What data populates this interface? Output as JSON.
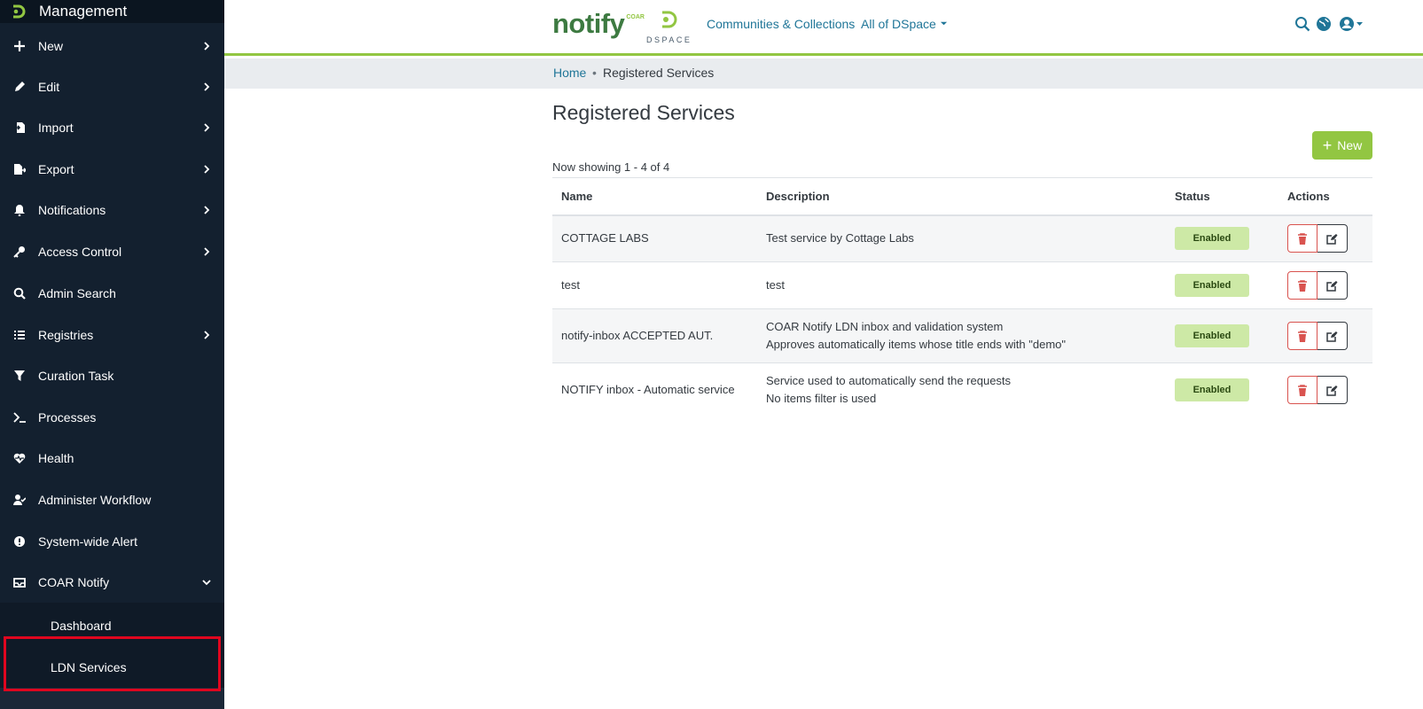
{
  "sidebar": {
    "title": "Management",
    "items": [
      {
        "label": "New",
        "icon": "plus-icon",
        "chevron": "right"
      },
      {
        "label": "Edit",
        "icon": "pencil-icon",
        "chevron": "right"
      },
      {
        "label": "Import",
        "icon": "file-import-icon",
        "chevron": "right"
      },
      {
        "label": "Export",
        "icon": "file-export-icon",
        "chevron": "right"
      },
      {
        "label": "Notifications",
        "icon": "bell-icon",
        "chevron": "right"
      },
      {
        "label": "Access Control",
        "icon": "key-icon",
        "chevron": "right"
      },
      {
        "label": "Admin Search",
        "icon": "search-icon",
        "chevron": ""
      },
      {
        "label": "Registries",
        "icon": "list-icon",
        "chevron": "right"
      },
      {
        "label": "Curation Task",
        "icon": "filter-icon",
        "chevron": ""
      },
      {
        "label": "Processes",
        "icon": "terminal-icon",
        "chevron": ""
      },
      {
        "label": "Health",
        "icon": "heartbeat-icon",
        "chevron": ""
      },
      {
        "label": "Administer Workflow",
        "icon": "user-check-icon",
        "chevron": ""
      },
      {
        "label": "System-wide Alert",
        "icon": "exclamation-circle-icon",
        "chevron": ""
      },
      {
        "label": "COAR Notify",
        "icon": "inbox-icon",
        "chevron": "down"
      }
    ],
    "subitems": [
      {
        "label": "Dashboard"
      },
      {
        "label": "LDN Services"
      }
    ]
  },
  "header": {
    "brand": "notify",
    "brand_sup": "COAR",
    "dspace": "DSPACE",
    "links": [
      "Communities & Collections",
      "All of DSpace"
    ]
  },
  "breadcrumb": {
    "home": "Home",
    "current": "Registered Services"
  },
  "main": {
    "title": "Registered Services",
    "new_label": "New",
    "showing": "Now showing 1 - 4 of 4",
    "columns": [
      "Name",
      "Description",
      "Status",
      "Actions"
    ],
    "rows": [
      {
        "name": "COTTAGE LABS",
        "desc1": "Test service by Cottage Labs",
        "desc2": "",
        "status": "Enabled"
      },
      {
        "name": "test",
        "desc1": "test",
        "desc2": "",
        "status": "Enabled"
      },
      {
        "name": "notify-inbox ACCEPTED AUT.",
        "desc1": "COAR Notify LDN inbox and validation system",
        "desc2": "Approves automatically items whose title ends with \"demo\"",
        "status": "Enabled"
      },
      {
        "name": "NOTIFY inbox - Automatic service",
        "desc1": "Service used to automatically send the requests",
        "desc2": "No items filter is used",
        "status": "Enabled"
      }
    ]
  },
  "colors": {
    "sidebar_bg": "#13202f",
    "accent_green": "#92c642",
    "link_blue": "#207698",
    "danger": "#d9534f",
    "highlight_red": "#e0061f"
  }
}
